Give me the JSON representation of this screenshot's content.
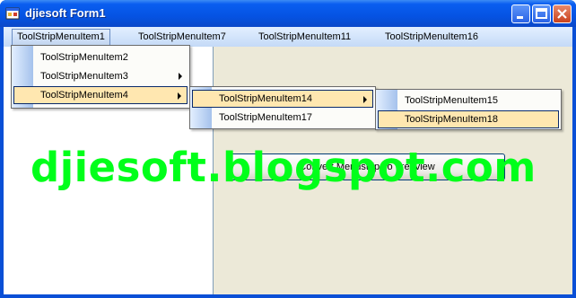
{
  "window": {
    "title": "djiesoft Form1"
  },
  "menubar": {
    "items": [
      {
        "label": "ToolStripMenuItem1"
      },
      {
        "label": "ToolStripMenuItem7"
      },
      {
        "label": "ToolStripMenuItem11"
      },
      {
        "label": "ToolStripMenuItem16"
      }
    ]
  },
  "menu1": {
    "items": [
      "ToolStripMenuItem2",
      "ToolStripMenuItem3",
      "ToolStripMenuItem4"
    ]
  },
  "menu4": {
    "items": [
      "ToolStripMenuItem14",
      "ToolStripMenuItem17"
    ]
  },
  "menu14": {
    "items": [
      "ToolStripMenuItem15",
      "ToolStripMenuItem18"
    ]
  },
  "button": {
    "convert_label": "Convert Menustrip To Treeview"
  },
  "watermark": "djiesoft.blogspot.com",
  "colors": {
    "highlight": "#ffe7b0",
    "watermark": "#00ff1a",
    "titlebar": "#0553e3"
  }
}
